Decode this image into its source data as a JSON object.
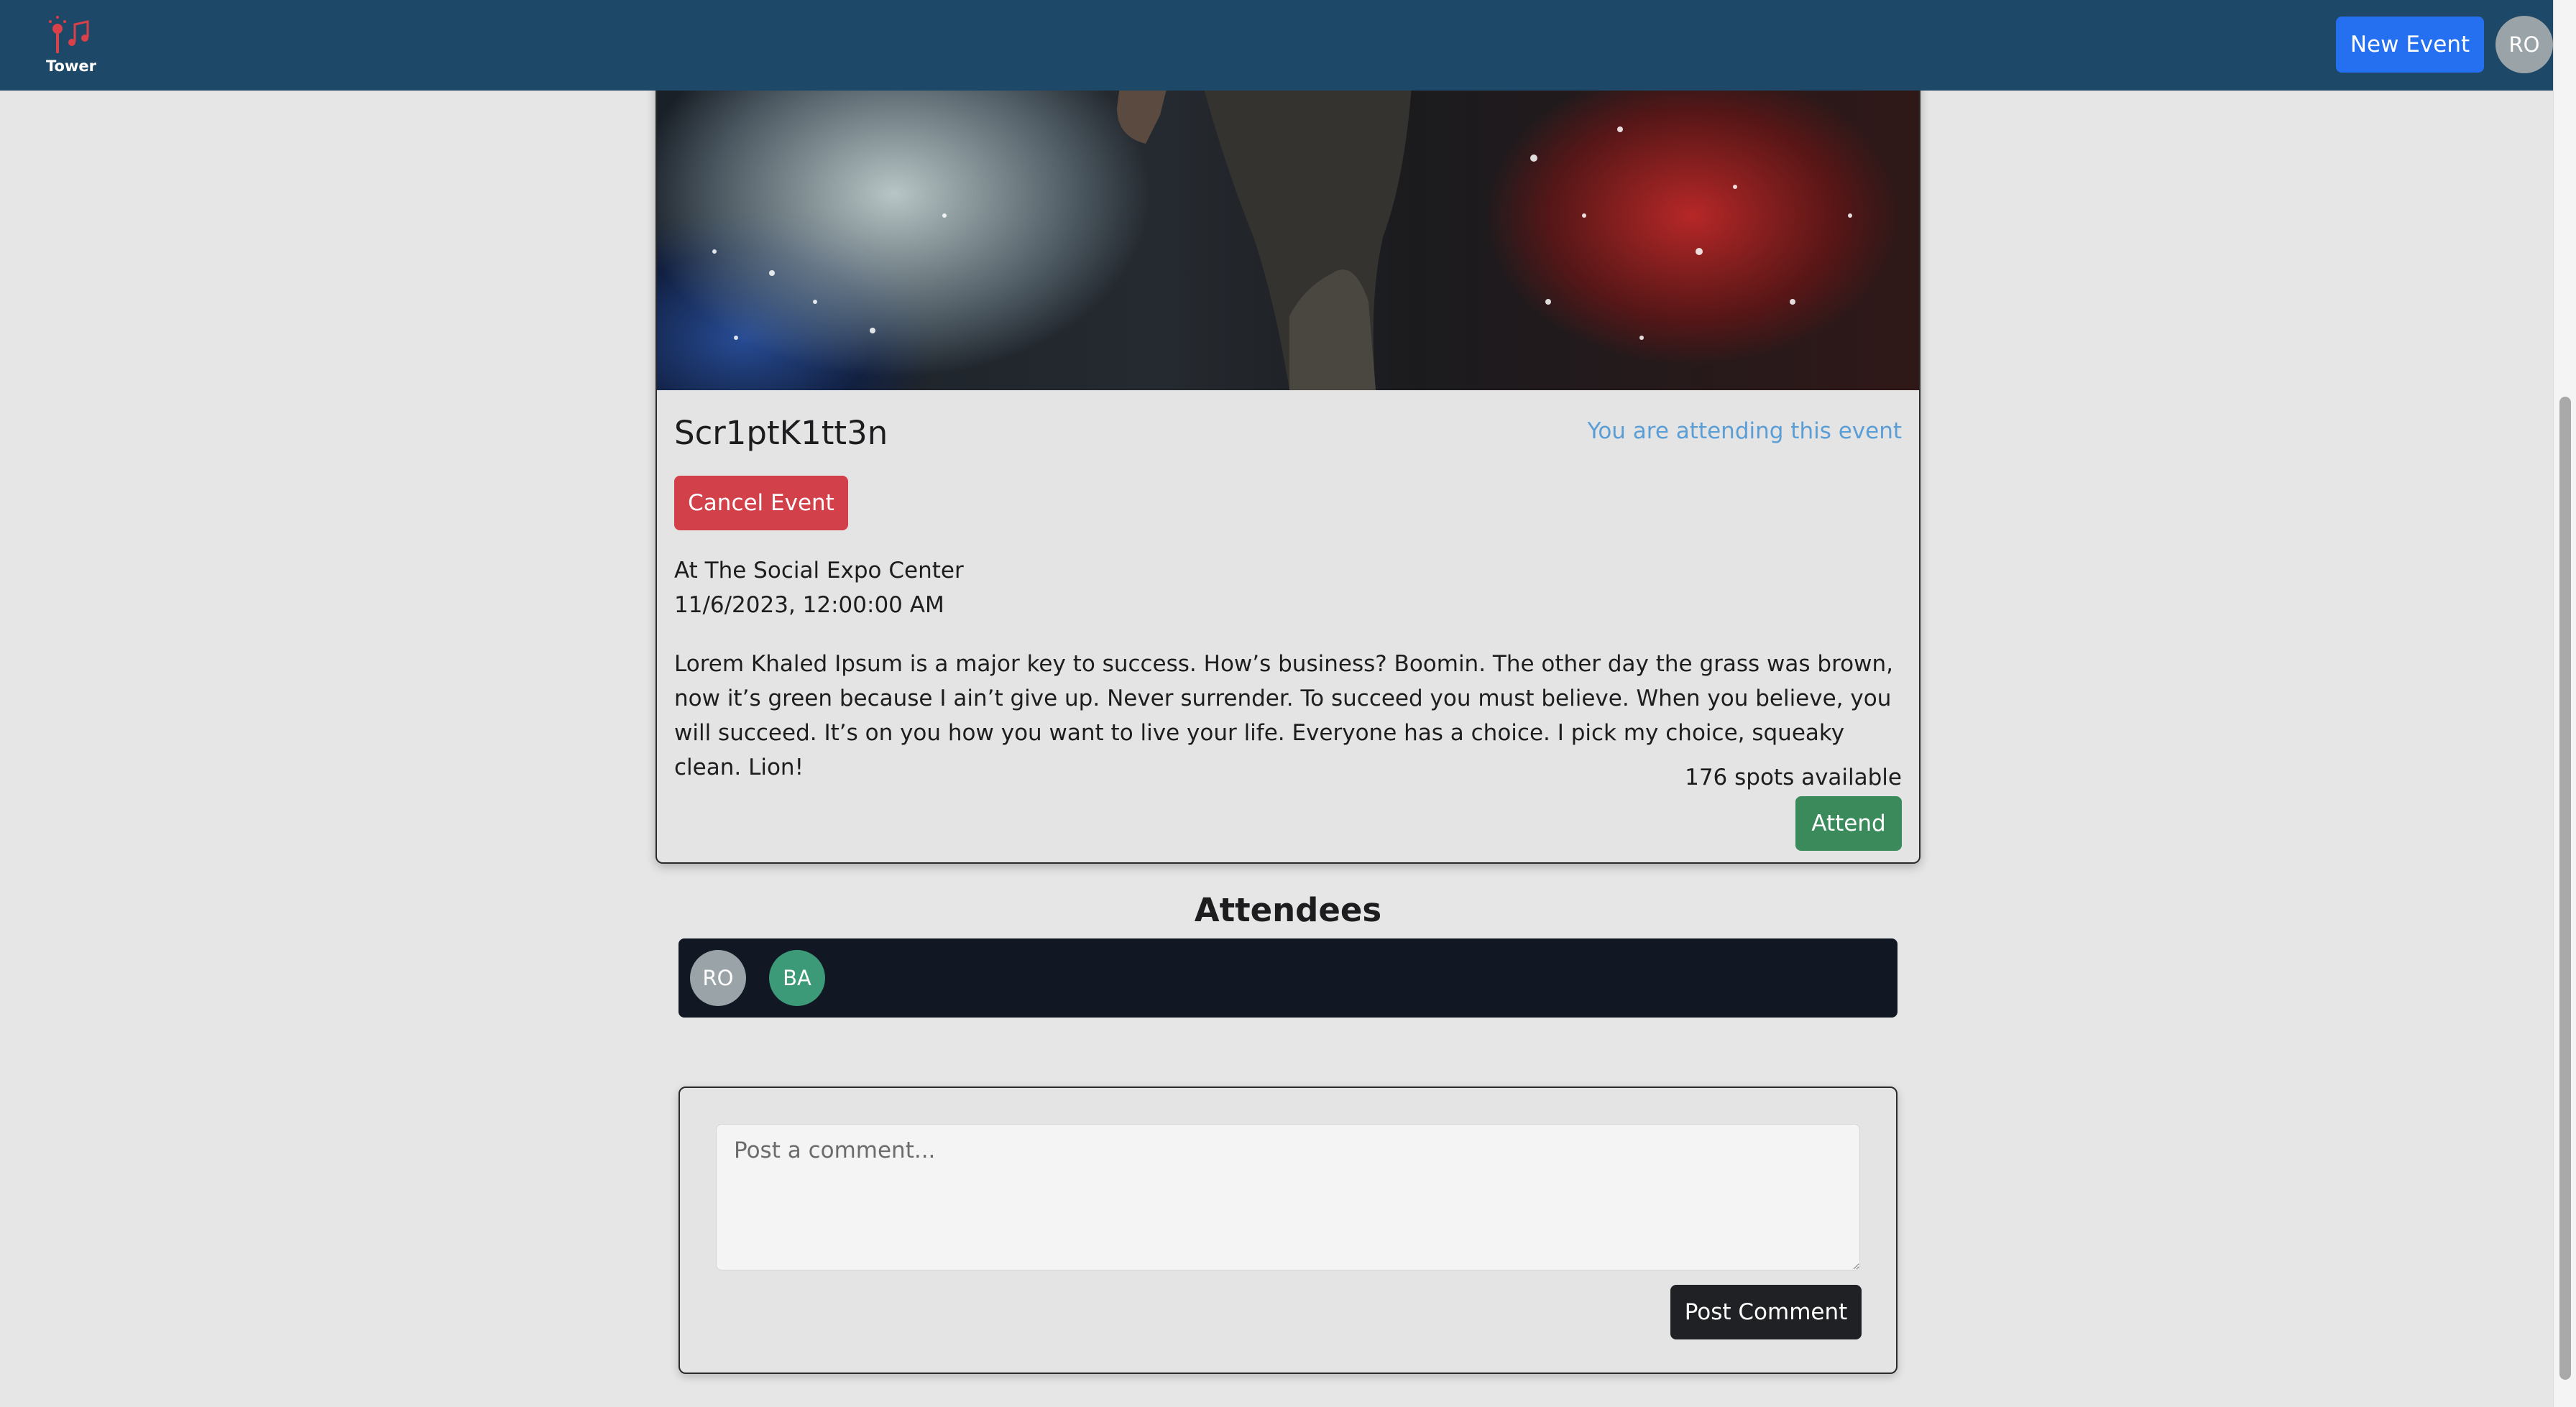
{
  "navbar": {
    "logo_text": "Tower",
    "new_event_label": "New Event",
    "user_initials": "RO",
    "colors": {
      "background": "#1e4867",
      "button": "#2570f0"
    }
  },
  "event": {
    "title": "Scr1ptK1tt3n",
    "attending_note": "You are attending this event",
    "cancel_label": "Cancel Event",
    "location": "At The Social Expo Center",
    "datetime": "11/6/2023, 12:00:00 AM",
    "description": "Lorem Khaled Ipsum is a major key to success. How’s business? Boomin. The other day the grass was brown, now it’s green because I ain’t give up. Never surrender. To succeed you must believe. When you believe, you will succeed. It’s on you how you want to live your life. Everyone has a choice. I pick my choice, squeaky clean. Lion!",
    "spots": "176 spots available",
    "attend_label": "Attend",
    "colors": {
      "cancel": "#d2404a",
      "attend": "#3a8a5c",
      "note": "#5b9ed6"
    }
  },
  "attendees": {
    "heading": "Attendees",
    "items": [
      {
        "initials": "RO",
        "color": "#9aa3a8"
      },
      {
        "initials": "BA",
        "color": "#3c9a78"
      }
    ]
  },
  "comment": {
    "placeholder": "Post a comment...",
    "post_label": "Post Comment"
  }
}
